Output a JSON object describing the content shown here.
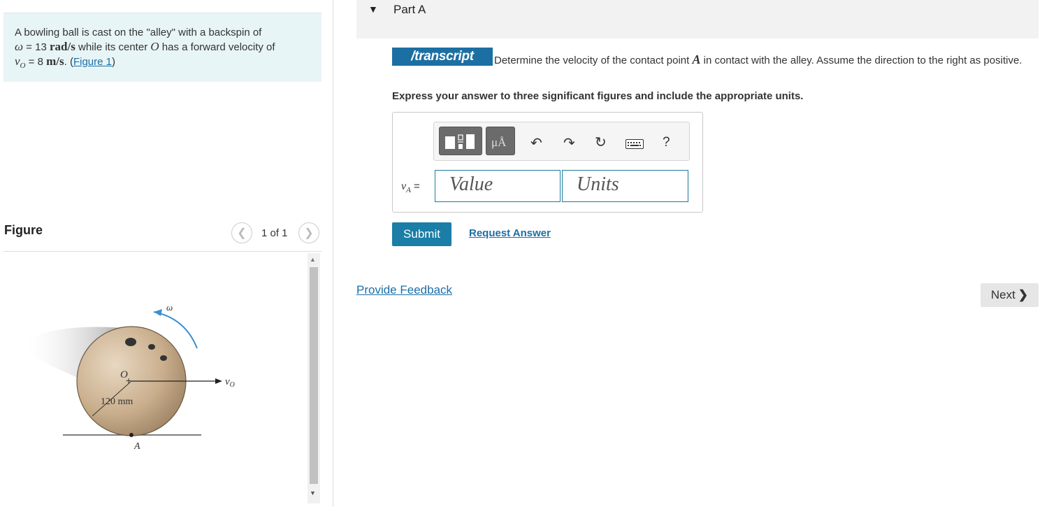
{
  "problem": {
    "intro": "A bowling ball is cast on the \"alley\" with a backspin of",
    "omega_symbol": "ω",
    "omega_eq": " = 13 ",
    "omega_unit": "rad/s",
    "mid": " while its center ",
    "center_symbol": "O",
    "mid2": " has a forward velocity of",
    "v_symbol": "v",
    "v_sub": "O",
    "v_eq": " = 8 ",
    "v_unit": "m/s",
    "period": ". (",
    "figure_link": "Figure 1",
    "close": ")"
  },
  "figure": {
    "title": "Figure",
    "counter": "1 of 1",
    "prev_icon": "chevron-left-icon",
    "next_icon": "chevron-right-icon",
    "label_omega": "ω",
    "label_o": "O",
    "label_vo": "v",
    "label_vo_sub": "O",
    "label_dim": "120 mm",
    "label_a": "A"
  },
  "part": {
    "title": "Part A",
    "caret_icon": "caret-down-icon"
  },
  "question": {
    "badge": "/transcript",
    "text_before": "Determine the velocity of the contact point ",
    "point": "A",
    "text_after": " in contact with the alley. Assume the direction to the right as positive.",
    "instructions": "Express your answer to three significant figures and include the appropriate units."
  },
  "answer": {
    "var_symbol": "v",
    "var_sub": "A",
    "var_eq": " =",
    "value_placeholder": "Value",
    "units_placeholder": "Units",
    "toolbar": {
      "templates_icon": "templates-icon",
      "units_label": "μÅ",
      "undo_icon": "undo-icon",
      "redo_icon": "redo-icon",
      "reset_icon": "reset-icon",
      "keyboard_icon": "keyboard-icon",
      "help_label": "?"
    }
  },
  "actions": {
    "submit": "Submit",
    "request_answer": "Request Answer",
    "provide_feedback": "Provide Feedback",
    "next": "Next",
    "next_icon": "chevron-right-icon"
  },
  "colors": {
    "accent": "#1a7ea6",
    "link": "#1a6fa8",
    "problem_bg": "#e8f5f7"
  }
}
